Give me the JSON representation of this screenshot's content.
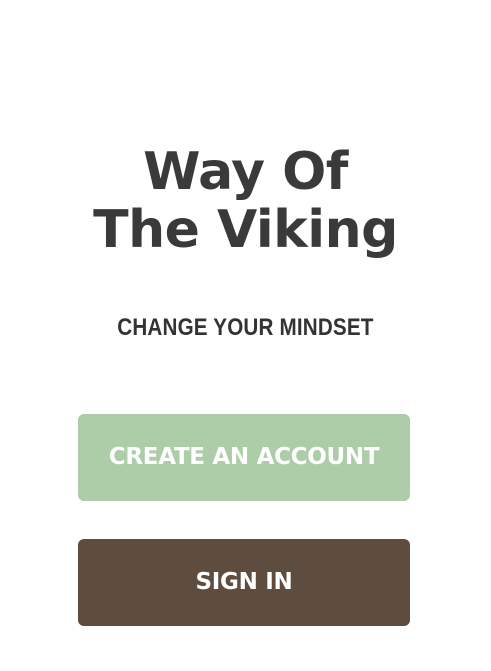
{
  "app": {
    "title_line1": "Way Of",
    "title_line2": "The Viking",
    "tagline": "CHANGE YOUR MINDSET"
  },
  "actions": {
    "create_account_label": "CREATE AN ACCOUNT",
    "sign_in_label": "SIGN IN"
  },
  "colors": {
    "background": "#ffffff",
    "title_text": "#3a3a3a",
    "create_account_bg": "#adcda9",
    "sign_in_bg": "#5e4c3e",
    "button_text": "#ffffff"
  }
}
